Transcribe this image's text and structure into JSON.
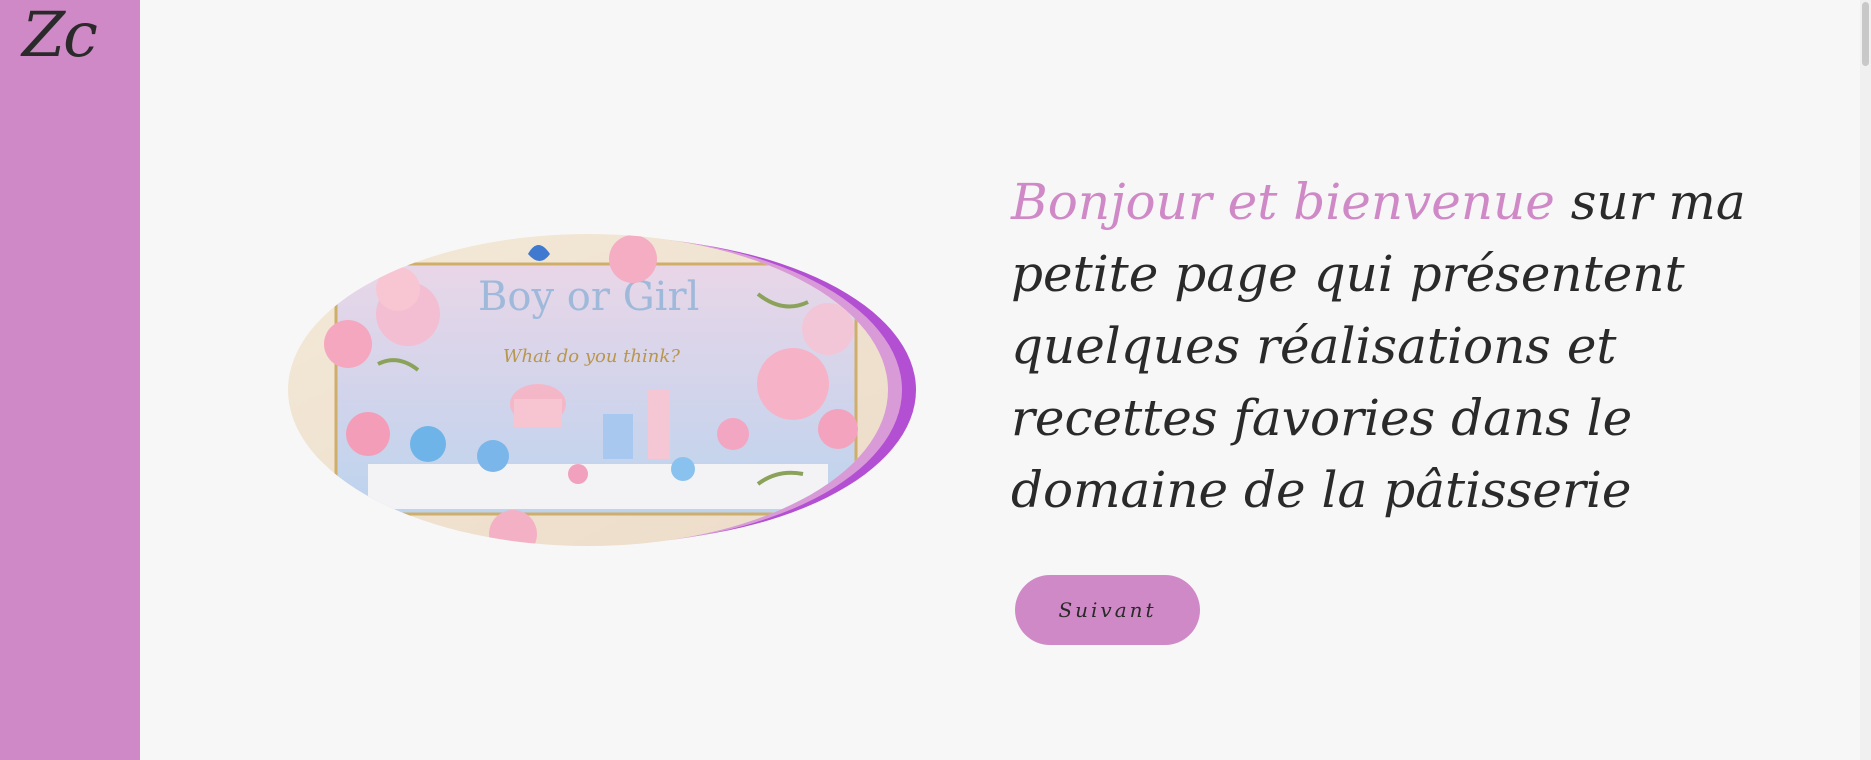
{
  "brand": {
    "logo_text": "Zc",
    "accent_color": "#d089c7"
  },
  "hero": {
    "image_icon": "party-dessert-table-photo",
    "image_text_1": "Boy or Girl",
    "image_text_2": "What do you think?",
    "welcome_accent": "Bonjour et bienvenue",
    "welcome_rest": " sur ma petite page qui présentent quelques réalisations et recettes favories dans le domaine de la pâtisserie",
    "next_label": "Suivant"
  }
}
